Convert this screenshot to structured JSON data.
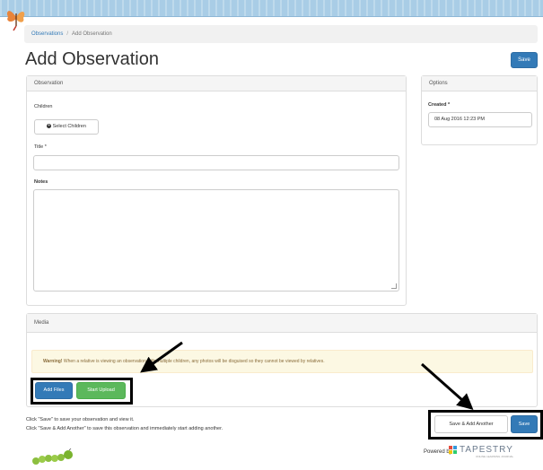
{
  "breadcrumb": {
    "parent": "Observations",
    "separator": "/",
    "current": "Add Observation"
  },
  "page_title": "Add Observation",
  "buttons": {
    "save_top": "Save",
    "select_children": "Select Children",
    "add_files": "Add Files",
    "start_upload": "Start Upload",
    "save_add_another": "Save & Add Another",
    "save_bottom": "Save"
  },
  "observation_panel": {
    "heading": "Observation",
    "children_label": "Children",
    "title_label": "Title *",
    "notes_label": "Notes"
  },
  "options_panel": {
    "heading": "Options",
    "created_label": "Created *",
    "created_value": "08 Aug 2016 12:23 PM"
  },
  "media_panel": {
    "heading": "Media",
    "warning_strong": "Warning!",
    "warning_text": "When a relative is viewing an observation with multiple children, any photos will be disguised so they cannot be viewed by relatives."
  },
  "hints": {
    "line1": "Click \"Save\" to save your observation and view it.",
    "line2": "Click \"Save & Add Another\" to save this observation and immediately start adding another."
  },
  "footer": {
    "powered_by": "Powered by",
    "brand": "TAPESTRY",
    "brand_sub": "ONLINE LEARNING JOURNAL"
  },
  "colors": {
    "primary": "#337ab7",
    "success": "#5cb85c",
    "warning_bg": "#fcf8e3",
    "topbar": "#a9cde6"
  }
}
